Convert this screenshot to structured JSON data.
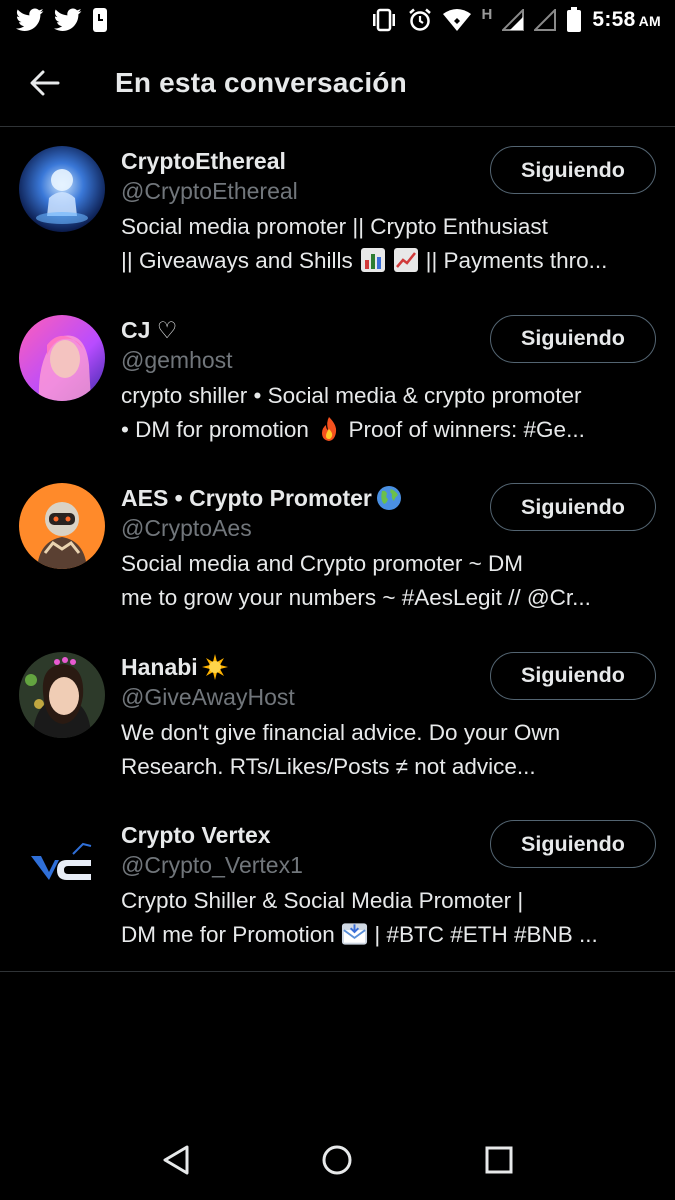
{
  "status_bar": {
    "time": "5:58",
    "ampm": "AM",
    "battery": "99",
    "network_letter": "H",
    "icons": [
      "twitter-icon",
      "twitter-icon",
      "phone-clock-icon",
      "vibrate-icon",
      "alarm-icon",
      "wifi-icon",
      "signal-icon",
      "signal-icon",
      "battery-icon"
    ]
  },
  "header": {
    "title": "En esta conversación",
    "back_icon": "arrow-left-icon"
  },
  "users": [
    {
      "name": "CryptoEthereal",
      "handle": "@CryptoEthereal",
      "bio_line1": "Social media promoter || Crypto Enthusiast",
      "bio_line2": "|| Giveaways and Shills",
      "bio_line2_end": "|| Payments thro...",
      "follow_label": "Siguiendo"
    },
    {
      "name": "CJ ♡",
      "handle": "@gemhost",
      "bio_line1": "crypto shiller • Social media & crypto promoter",
      "bio_line2": "• DM for promotion",
      "bio_line2_end": "Proof of winners: #Ge...",
      "follow_label": "Siguiendo"
    },
    {
      "name": "AES • Crypto Promoter",
      "handle": "@CryptoAes",
      "bio_line1": "Social media and Crypto promoter ~ DM",
      "bio_line2": "me to grow your numbers ~ #AesLegit // @Cr...",
      "follow_label": "Siguiendo"
    },
    {
      "name": "Hanabi",
      "handle": "@GiveAwayHost",
      "bio_line1": "We don't give financial advice. Do your Own",
      "bio_line2": "Research. RTs/Likes/Posts ≠ not advice...",
      "follow_label": "Siguiendo"
    },
    {
      "name": "Crypto Vertex",
      "handle": "@Crypto_Vertex1",
      "bio_line1": "Crypto Shiller & Social Media Promoter |",
      "bio_line2": "DM me for Promotion",
      "bio_line2_end": "| #BTC #ETH #BNB ...",
      "follow_label": "Siguiendo"
    }
  ],
  "nav_bar": {
    "icons": [
      "back-triangle-icon",
      "home-circle-icon",
      "recents-square-icon"
    ]
  },
  "colors": {
    "background": "#000000",
    "text_primary": "#e7e9ea",
    "text_secondary": "#71767b",
    "divider": "#2f3336"
  }
}
